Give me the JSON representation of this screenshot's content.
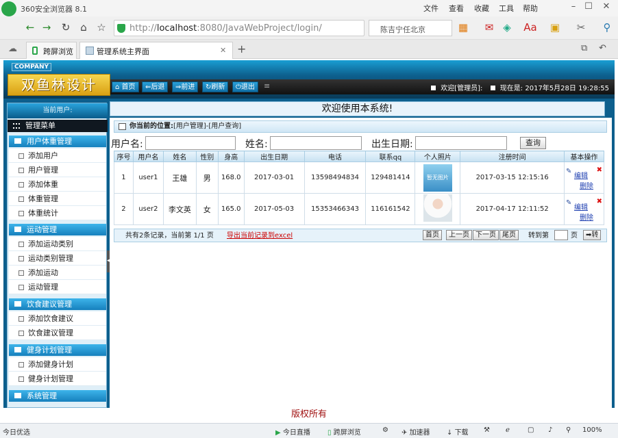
{
  "browser": {
    "title": "360安全浏览器 8.1",
    "menu": [
      "文件",
      "查看",
      "收藏",
      "工具",
      "帮助"
    ],
    "url_prefix": "http://",
    "url_host": "localhost",
    "url_rest": ":8080/JavaWebProject/login/",
    "search_text": "陈吉宁任北京",
    "tabs": [
      "跨屏浏览",
      "管理系统主界面"
    ]
  },
  "app": {
    "company": "COMPANY",
    "logo": "双鱼林设计",
    "toolbar": [
      "首页",
      "后退",
      "前进",
      "刷新",
      "退出"
    ],
    "welcome_user": "欢迎[管理员]:",
    "now_label": "现在是:",
    "datetime": "2017年5月28日 19:28:55",
    "welcome_msg": "欢迎使用本系统!"
  },
  "sidebar": {
    "current_user": "当前用户:",
    "menu_title": "管理菜单",
    "groups": [
      {
        "title": "用户体重管理",
        "items": [
          "添加用户",
          "用户管理",
          "添加体重",
          "体重管理",
          "体重统计"
        ]
      },
      {
        "title": "运动管理",
        "items": [
          "添加运动类别",
          "运动类别管理",
          "添加运动",
          "运动管理"
        ]
      },
      {
        "title": "饮食建议管理",
        "items": [
          "添加饮食建议",
          "饮食建议管理"
        ]
      },
      {
        "title": "健身计划管理",
        "items": [
          "添加健身计划",
          "健身计划管理"
        ]
      },
      {
        "title": "系统管理",
        "items": []
      }
    ]
  },
  "main": {
    "location_label": "你当前的位置:",
    "location_path": "[用户管理]-[用户查询]",
    "search": {
      "username_label": "用户名:",
      "name_label": "姓名:",
      "birth_label": "出生日期:",
      "query_button": "查询"
    },
    "columns": [
      "序号",
      "用户名",
      "姓名",
      "性别",
      "身高",
      "出生日期",
      "电话",
      "联系qq",
      "个人照片",
      "注册时间",
      "基本操作"
    ],
    "rows": [
      [
        "1",
        "user1",
        "王雄",
        "男",
        "168.0",
        "2017-03-01",
        "13598494834",
        "129481414",
        "",
        "2017-03-15 12:15:16"
      ],
      [
        "2",
        "user2",
        "李文英",
        "女",
        "165.0",
        "2017-05-03",
        "15353466343",
        "116161542",
        "",
        "2017-04-17 12:11:52"
      ]
    ],
    "photo_placeholder": "暂无图片",
    "edit": "编辑",
    "delete": "删除",
    "pager": {
      "summary": "共有2条记录，当前第 1/1 页",
      "export": "导出当前记录到excel",
      "first": "首页",
      "prev": "上一页",
      "next": "下一页",
      "last": "尾页",
      "goto": "转到第",
      "page": "页",
      "go": "转"
    }
  },
  "footer": "版权所有",
  "statusbar": {
    "left": "今日优选",
    "items": [
      "今日直播",
      "跨屏浏览",
      "加速器",
      "下载"
    ],
    "zoom": "100%"
  }
}
